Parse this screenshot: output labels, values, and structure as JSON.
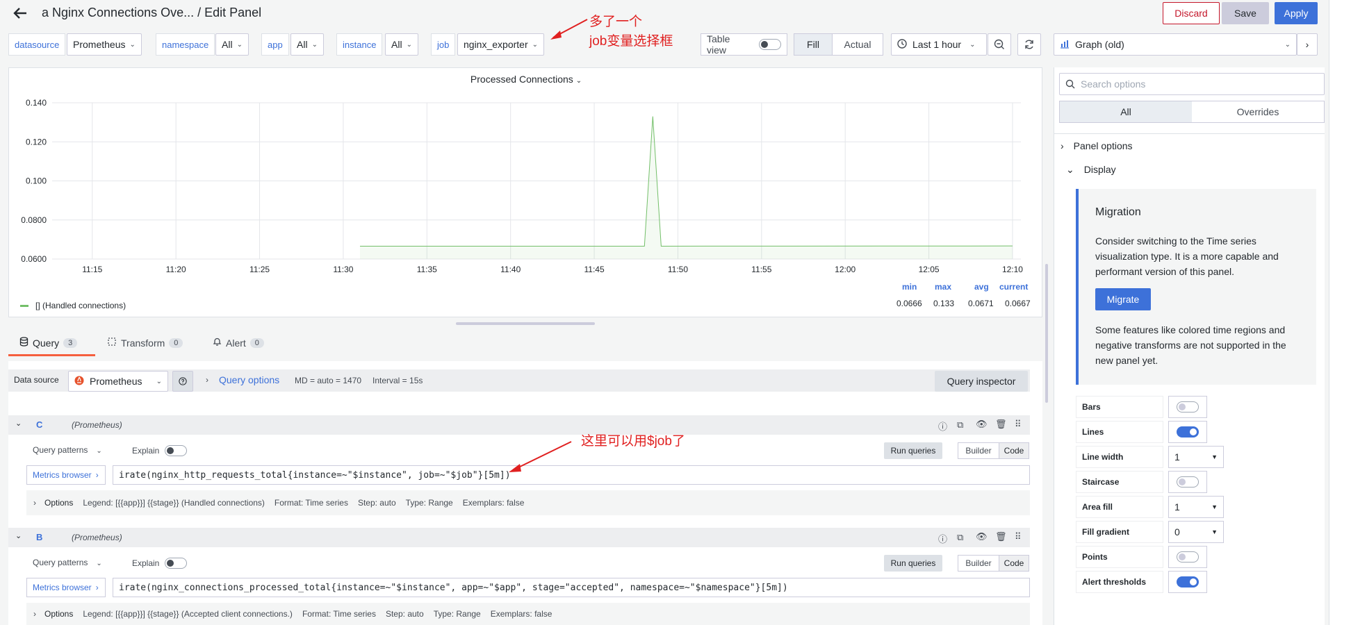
{
  "header": {
    "title": "a Nginx Connections Ove... / Edit Panel",
    "discard_label": "Discard",
    "save_label": "Save",
    "apply_label": "Apply"
  },
  "variables": [
    {
      "label": "datasource",
      "value": "Prometheus"
    },
    {
      "label": "namespace",
      "value": "All"
    },
    {
      "label": "app",
      "value": "All"
    },
    {
      "label": "instance",
      "value": "All"
    },
    {
      "label": "job",
      "value": "nginx_exporter"
    }
  ],
  "annotations": {
    "job_var_line1": "多了一个",
    "job_var_line2": "job变量选择框",
    "job_query": "这里可以用$job了"
  },
  "toolbar": {
    "table_view_label": "Table view",
    "fill_label": "Fill",
    "actual_label": "Actual",
    "time_range": "Last 1 hour",
    "viz_type": "Graph (old)"
  },
  "chart_data": {
    "type": "line",
    "title": "Processed Connections",
    "x_ticks": [
      "11:15",
      "11:20",
      "11:25",
      "11:30",
      "11:35",
      "11:40",
      "11:45",
      "11:50",
      "11:55",
      "12:00",
      "12:05",
      "12:10"
    ],
    "y_ticks": [
      "0.140",
      "0.120",
      "0.100",
      "0.0800",
      "0.0600"
    ],
    "ylim": [
      0.06,
      0.14
    ],
    "series": [
      {
        "name": "[] (Handled connections)",
        "color": "#73bf69",
        "points": [
          [
            "11:31",
            0.0666
          ],
          [
            "11:48",
            0.0666
          ],
          [
            "11:48:30",
            0.133
          ],
          [
            "11:49",
            0.0666
          ],
          [
            "12:10",
            0.0667
          ]
        ]
      }
    ],
    "legend": {
      "headers": [
        "min",
        "max",
        "avg",
        "current"
      ],
      "values": [
        "0.0666",
        "0.133",
        "0.0671",
        "0.0667"
      ]
    },
    "grid": true
  },
  "query_tabs": [
    {
      "label": "Query",
      "count": "3"
    },
    {
      "label": "Transform",
      "count": "0"
    },
    {
      "label": "Alert",
      "count": "0"
    }
  ],
  "query_bar": {
    "data_source_label": "Data source",
    "data_source_value": "Prometheus",
    "query_options_label": "Query options",
    "md_info": "MD = auto = 1470",
    "interval_info": "Interval = 15s",
    "inspector_label": "Query inspector"
  },
  "queries": [
    {
      "ref": "C",
      "source": "(Prometheus)",
      "patterns_label": "Query patterns",
      "explain_label": "Explain",
      "run_label": "Run queries",
      "builder_label": "Builder",
      "code_label": "Code",
      "metrics_browser_label": "Metrics browser",
      "expr": "irate(nginx_http_requests_total{instance=~\"$instance\", job=~\"$job\"}[5m])",
      "options_label": "Options",
      "legend": "Legend: [{{app}}] {{stage}} (Handled connections)",
      "format": "Format: Time series",
      "step": "Step: auto",
      "type": "Type: Range",
      "exemplars": "Exemplars: false"
    },
    {
      "ref": "B",
      "source": "(Prometheus)",
      "patterns_label": "Query patterns",
      "explain_label": "Explain",
      "run_label": "Run queries",
      "builder_label": "Builder",
      "code_label": "Code",
      "metrics_browser_label": "Metrics browser",
      "expr": "irate(nginx_connections_processed_total{instance=~\"$instance\", app=~\"$app\", stage=\"accepted\", namespace=~\"$namespace\"}[5m])",
      "options_label": "Options",
      "legend": "Legend: [{{app}}] {{stage}} (Accepted client connections.)",
      "format": "Format: Time series",
      "step": "Step: auto",
      "type": "Type: Range",
      "exemplars": "Exemplars: false"
    }
  ],
  "options_pane": {
    "search_placeholder": "Search options",
    "all_label": "All",
    "overrides_label": "Overrides",
    "panel_options_label": "Panel options",
    "display_label": "Display",
    "migration": {
      "title": "Migration",
      "body": "Consider switching to the Time series visualization type. It is a more capable and performant version of this panel.",
      "button": "Migrate",
      "note": "Some features like colored time regions and negative transforms are not supported in the new panel yet."
    },
    "fields": [
      {
        "label": "Bars",
        "kind": "toggle",
        "on": false
      },
      {
        "label": "Lines",
        "kind": "toggle",
        "on": true
      },
      {
        "label": "Line width",
        "kind": "select",
        "value": "1"
      },
      {
        "label": "Staircase",
        "kind": "toggle",
        "on": false
      },
      {
        "label": "Area fill",
        "kind": "select",
        "value": "1"
      },
      {
        "label": "Fill gradient",
        "kind": "select",
        "value": "0"
      },
      {
        "label": "Points",
        "kind": "toggle",
        "on": false
      },
      {
        "label": "Alert thresholds",
        "kind": "toggle",
        "on": true
      }
    ]
  }
}
